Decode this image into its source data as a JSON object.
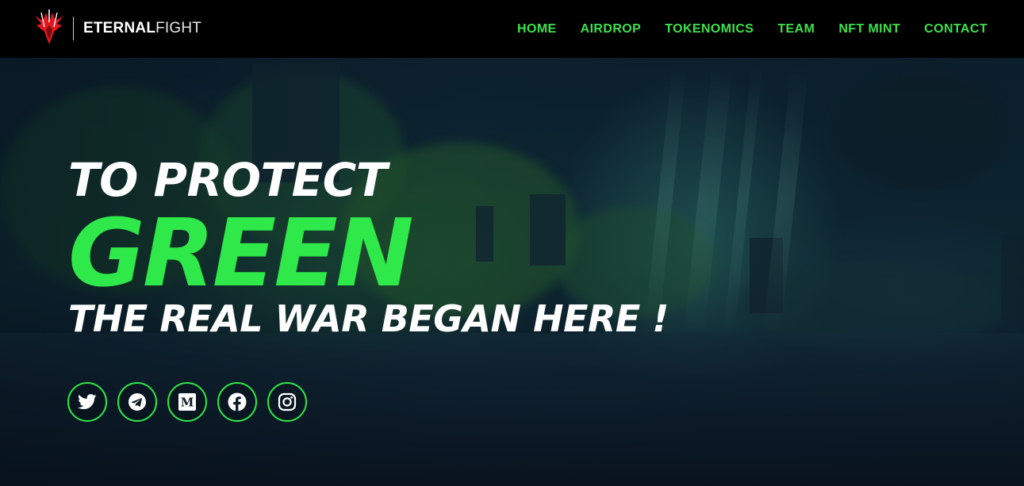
{
  "header": {
    "brand": {
      "name_bold": "ETERNAL",
      "name_light": "FIGHT",
      "logo_icon": "eternalfight-logo-icon"
    },
    "nav": [
      {
        "label": "HOME"
      },
      {
        "label": "AIRDROP"
      },
      {
        "label": "TOKENOMICS"
      },
      {
        "label": "TEAM"
      },
      {
        "label": "NFT MINT"
      },
      {
        "label": "CONTACT"
      }
    ]
  },
  "hero": {
    "line1": "TO PROTECT",
    "line2": "GREEN",
    "line3": "THE REAL WAR BEGAN HERE !"
  },
  "socials": [
    {
      "icon": "twitter-icon"
    },
    {
      "icon": "telegram-icon"
    },
    {
      "icon": "medium-icon"
    },
    {
      "icon": "facebook-icon"
    },
    {
      "icon": "instagram-icon"
    }
  ],
  "colors": {
    "accent_green": "#2fe84a",
    "nav_green": "#3ee04a",
    "header_bg": "#000000",
    "logo_red": "#e0171f"
  }
}
